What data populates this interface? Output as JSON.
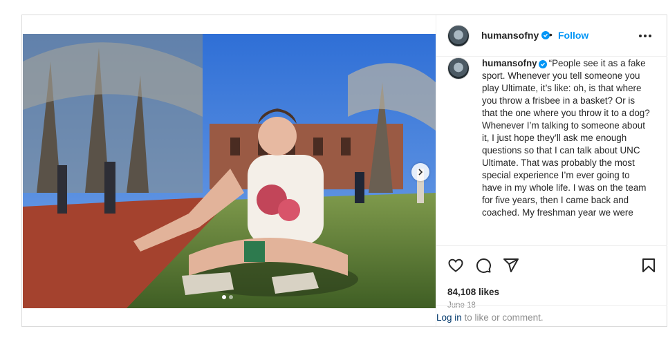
{
  "post": {
    "username": "humansofny",
    "follow_label": "Follow",
    "separator": "•",
    "caption": "“People see it as a fake sport. Whenever you tell someone you play Ultimate, it’s like: oh, is that where you throw a frisbee in a basket? Or is that the one where you throw it to a dog? Whenever I’m talking to someone about it, I just hope they’ll ask me enough questions so that I can talk about UNC Ultimate. That was probably the most special experience I’m ever going to have in my whole life. I was on the team for five years, then I came back and coached. My freshman year we were",
    "likes": "84,108 likes",
    "date": "June 18",
    "login_link": "Log in",
    "login_suffix": " to like or comment."
  },
  "media": {
    "description_icon": "photo-woman-sitting-on-grass-park",
    "carousel_total": 2,
    "carousel_active": 1
  },
  "icons": {
    "verified": "verified-badge-icon",
    "more": "more-options-icon",
    "like": "heart-icon",
    "comment": "comment-icon",
    "share": "share-icon",
    "save": "bookmark-icon",
    "next": "chevron-right-icon"
  },
  "colors": {
    "accent": "#0095f6",
    "text": "#262626",
    "muted": "#8e8e8e",
    "border": "#dbdbdb"
  }
}
